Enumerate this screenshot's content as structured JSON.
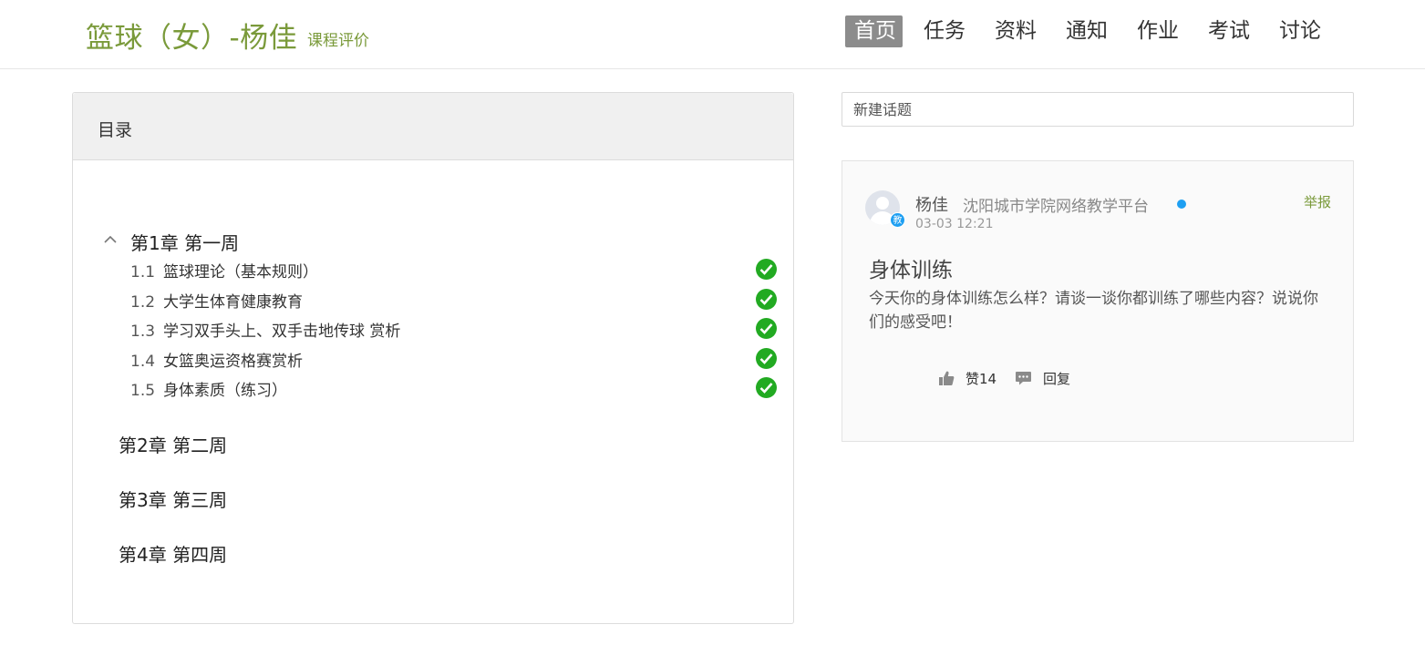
{
  "header": {
    "course_title": "篮球（女）-杨佳",
    "course_subtitle": "课程评价",
    "nav": [
      {
        "label": "首页",
        "active": true
      },
      {
        "label": "任务",
        "active": false
      },
      {
        "label": "资料",
        "active": false
      },
      {
        "label": "通知",
        "active": false
      },
      {
        "label": "作业",
        "active": false
      },
      {
        "label": "考试",
        "active": false
      },
      {
        "label": "讨论",
        "active": false
      }
    ]
  },
  "catalog": {
    "title": "目录",
    "chapters": [
      {
        "label": "第1章 第一周",
        "expanded": true,
        "sections": [
          {
            "num": "1.1",
            "title": "篮球理论（基本规则）",
            "completed": true
          },
          {
            "num": "1.2",
            "title": "大学生体育健康教育",
            "completed": true
          },
          {
            "num": "1.3",
            "title": "学习双手头上、双手击地传球 赏析",
            "completed": true
          },
          {
            "num": "1.4",
            "title": "女篮奥运资格赛赏析",
            "completed": true
          },
          {
            "num": "1.5",
            "title": "身体素质（练习）",
            "completed": true
          }
        ]
      },
      {
        "label": "第2章 第二周",
        "expanded": false
      },
      {
        "label": "第3章 第三周",
        "expanded": false
      },
      {
        "label": "第4章 第四周",
        "expanded": false
      }
    ]
  },
  "discussion": {
    "new_topic_placeholder": "新建话题",
    "topic": {
      "author": "杨佳",
      "teacher_badge": "教",
      "school": "沈阳城市学院网络教学平台",
      "report_label": "举报",
      "time": "03-03 12:21",
      "title": "身体训练",
      "body": "今天你的身体训练怎么样？请谈一谈你都训练了哪些内容？说说你们的感受吧！",
      "like_label": "赞14",
      "reply_label": "回复"
    }
  },
  "colors": {
    "accent_green": "#7a9a3a",
    "check_green": "#22aa22",
    "online_blue": "#1e9ff2",
    "nav_active_bg": "#8c8c8c"
  }
}
